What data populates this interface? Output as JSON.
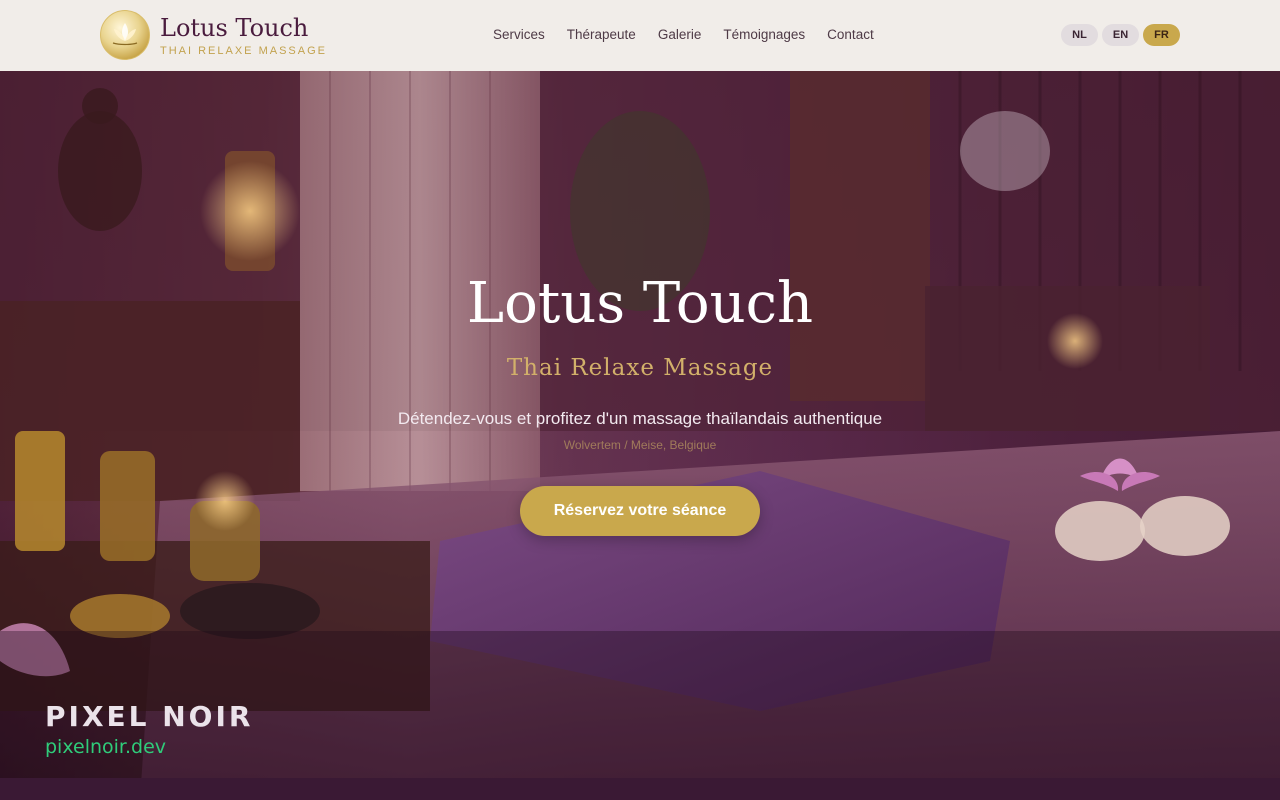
{
  "header": {
    "brand_title": "Lotus Touch",
    "brand_subtitle": "THAI RELAXE MASSAGE",
    "logo_icon": "lotus-logo-icon",
    "nav": [
      {
        "label": "Services"
      },
      {
        "label": "Thérapeute"
      },
      {
        "label": "Galerie"
      },
      {
        "label": "Témoignages"
      },
      {
        "label": "Contact"
      }
    ],
    "languages": [
      {
        "code": "NL",
        "active": false
      },
      {
        "code": "EN",
        "active": false
      },
      {
        "code": "FR",
        "active": true
      }
    ]
  },
  "hero": {
    "title": "Lotus Touch",
    "subtitle": "Thai Relaxe Massage",
    "tagline": "Détendez-vous et profitez d'un massage thaïlandais authentique",
    "location": "Wolvertem / Meise, Belgique",
    "cta_label": "Réservez votre séance"
  },
  "watermark": {
    "title": "PIXEL NOIR",
    "url": "pixelnoir.dev"
  },
  "colors": {
    "accent_gold": "#c9a84c",
    "brand_plum": "#4a1c3e",
    "header_bg": "#f1ede9",
    "watermark_green": "#2fcc7a"
  }
}
